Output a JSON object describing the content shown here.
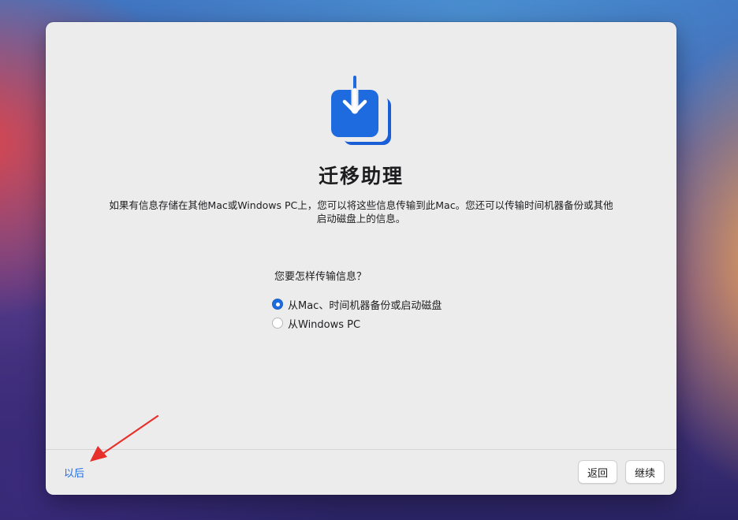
{
  "window": {
    "title": "迁移助理",
    "description": "如果有信息存储在其他Mac或Windows PC上，您可以将这些信息传输到此Mac。您还可以传输时间机器备份或其他启动磁盘上的信息。",
    "question": "您要怎样传输信息？",
    "options": [
      {
        "label": "从Mac、时间机器备份或启动磁盘",
        "selected": true
      },
      {
        "label": "从Windows PC",
        "selected": false
      }
    ],
    "icon": "migration-assistant-icon"
  },
  "footer": {
    "later_label": "以后",
    "back_label": "返回",
    "continue_label": "继续"
  },
  "annotation": {
    "icon": "red-arrow-pointer",
    "color": "#e8302a"
  },
  "colors": {
    "accent": "#1e6be0",
    "window_bg": "#ececec"
  }
}
